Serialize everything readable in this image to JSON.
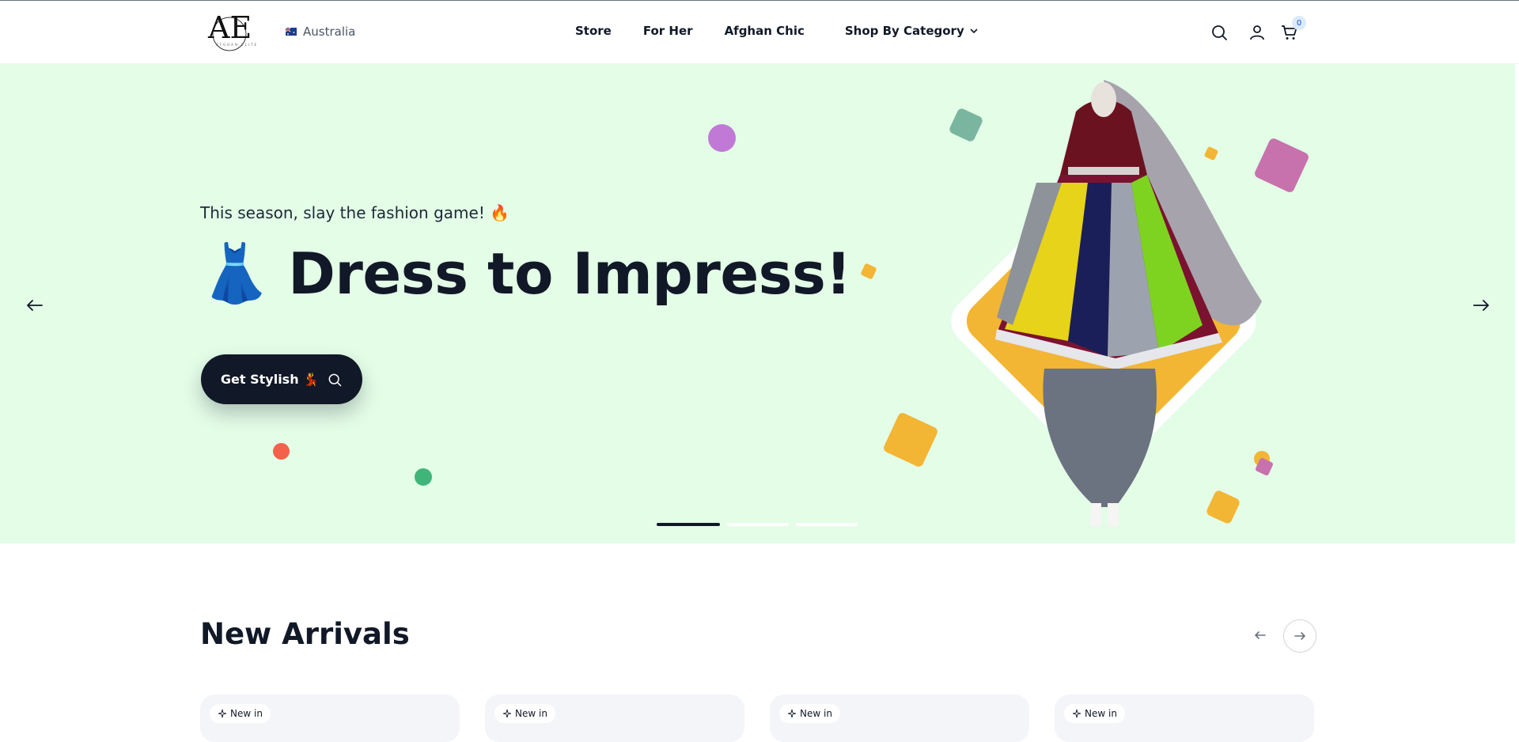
{
  "header": {
    "logo_text": "AE",
    "country": "Australia",
    "nav": [
      "Store",
      "For Her",
      "Afghan Chic"
    ],
    "category_label": "Shop By Category",
    "cart_count": "0"
  },
  "hero": {
    "tagline": "This season, slay the fashion game! 🔥",
    "headline": "Dress to Impress!",
    "headline_emoji": "👗",
    "cta_label": "Get Stylish 💃",
    "background": "#e3fde7",
    "accent": "#f3b534"
  },
  "slider": {
    "slides": 3,
    "active": 1
  },
  "new_arrivals": {
    "title": "New Arrivals",
    "cards": [
      {
        "badge": "New in"
      },
      {
        "badge": "New in"
      },
      {
        "badge": "New in"
      },
      {
        "badge": "New in"
      }
    ]
  }
}
